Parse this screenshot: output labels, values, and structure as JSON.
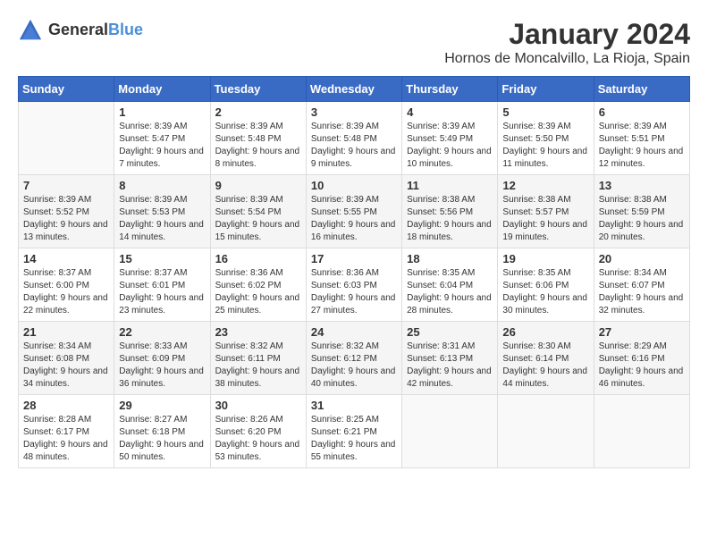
{
  "header": {
    "logo_general": "General",
    "logo_blue": "Blue",
    "month": "January 2024",
    "location": "Hornos de Moncalvillo, La Rioja, Spain"
  },
  "weekdays": [
    "Sunday",
    "Monday",
    "Tuesday",
    "Wednesday",
    "Thursday",
    "Friday",
    "Saturday"
  ],
  "weeks": [
    [
      {
        "day": "",
        "sunrise": "",
        "sunset": "",
        "daylight": ""
      },
      {
        "day": "1",
        "sunrise": "Sunrise: 8:39 AM",
        "sunset": "Sunset: 5:47 PM",
        "daylight": "Daylight: 9 hours and 7 minutes."
      },
      {
        "day": "2",
        "sunrise": "Sunrise: 8:39 AM",
        "sunset": "Sunset: 5:48 PM",
        "daylight": "Daylight: 9 hours and 8 minutes."
      },
      {
        "day": "3",
        "sunrise": "Sunrise: 8:39 AM",
        "sunset": "Sunset: 5:48 PM",
        "daylight": "Daylight: 9 hours and 9 minutes."
      },
      {
        "day": "4",
        "sunrise": "Sunrise: 8:39 AM",
        "sunset": "Sunset: 5:49 PM",
        "daylight": "Daylight: 9 hours and 10 minutes."
      },
      {
        "day": "5",
        "sunrise": "Sunrise: 8:39 AM",
        "sunset": "Sunset: 5:50 PM",
        "daylight": "Daylight: 9 hours and 11 minutes."
      },
      {
        "day": "6",
        "sunrise": "Sunrise: 8:39 AM",
        "sunset": "Sunset: 5:51 PM",
        "daylight": "Daylight: 9 hours and 12 minutes."
      }
    ],
    [
      {
        "day": "7",
        "sunrise": "Sunrise: 8:39 AM",
        "sunset": "Sunset: 5:52 PM",
        "daylight": "Daylight: 9 hours and 13 minutes."
      },
      {
        "day": "8",
        "sunrise": "Sunrise: 8:39 AM",
        "sunset": "Sunset: 5:53 PM",
        "daylight": "Daylight: 9 hours and 14 minutes."
      },
      {
        "day": "9",
        "sunrise": "Sunrise: 8:39 AM",
        "sunset": "Sunset: 5:54 PM",
        "daylight": "Daylight: 9 hours and 15 minutes."
      },
      {
        "day": "10",
        "sunrise": "Sunrise: 8:39 AM",
        "sunset": "Sunset: 5:55 PM",
        "daylight": "Daylight: 9 hours and 16 minutes."
      },
      {
        "day": "11",
        "sunrise": "Sunrise: 8:38 AM",
        "sunset": "Sunset: 5:56 PM",
        "daylight": "Daylight: 9 hours and 18 minutes."
      },
      {
        "day": "12",
        "sunrise": "Sunrise: 8:38 AM",
        "sunset": "Sunset: 5:57 PM",
        "daylight": "Daylight: 9 hours and 19 minutes."
      },
      {
        "day": "13",
        "sunrise": "Sunrise: 8:38 AM",
        "sunset": "Sunset: 5:59 PM",
        "daylight": "Daylight: 9 hours and 20 minutes."
      }
    ],
    [
      {
        "day": "14",
        "sunrise": "Sunrise: 8:37 AM",
        "sunset": "Sunset: 6:00 PM",
        "daylight": "Daylight: 9 hours and 22 minutes."
      },
      {
        "day": "15",
        "sunrise": "Sunrise: 8:37 AM",
        "sunset": "Sunset: 6:01 PM",
        "daylight": "Daylight: 9 hours and 23 minutes."
      },
      {
        "day": "16",
        "sunrise": "Sunrise: 8:36 AM",
        "sunset": "Sunset: 6:02 PM",
        "daylight": "Daylight: 9 hours and 25 minutes."
      },
      {
        "day": "17",
        "sunrise": "Sunrise: 8:36 AM",
        "sunset": "Sunset: 6:03 PM",
        "daylight": "Daylight: 9 hours and 27 minutes."
      },
      {
        "day": "18",
        "sunrise": "Sunrise: 8:35 AM",
        "sunset": "Sunset: 6:04 PM",
        "daylight": "Daylight: 9 hours and 28 minutes."
      },
      {
        "day": "19",
        "sunrise": "Sunrise: 8:35 AM",
        "sunset": "Sunset: 6:06 PM",
        "daylight": "Daylight: 9 hours and 30 minutes."
      },
      {
        "day": "20",
        "sunrise": "Sunrise: 8:34 AM",
        "sunset": "Sunset: 6:07 PM",
        "daylight": "Daylight: 9 hours and 32 minutes."
      }
    ],
    [
      {
        "day": "21",
        "sunrise": "Sunrise: 8:34 AM",
        "sunset": "Sunset: 6:08 PM",
        "daylight": "Daylight: 9 hours and 34 minutes."
      },
      {
        "day": "22",
        "sunrise": "Sunrise: 8:33 AM",
        "sunset": "Sunset: 6:09 PM",
        "daylight": "Daylight: 9 hours and 36 minutes."
      },
      {
        "day": "23",
        "sunrise": "Sunrise: 8:32 AM",
        "sunset": "Sunset: 6:11 PM",
        "daylight": "Daylight: 9 hours and 38 minutes."
      },
      {
        "day": "24",
        "sunrise": "Sunrise: 8:32 AM",
        "sunset": "Sunset: 6:12 PM",
        "daylight": "Daylight: 9 hours and 40 minutes."
      },
      {
        "day": "25",
        "sunrise": "Sunrise: 8:31 AM",
        "sunset": "Sunset: 6:13 PM",
        "daylight": "Daylight: 9 hours and 42 minutes."
      },
      {
        "day": "26",
        "sunrise": "Sunrise: 8:30 AM",
        "sunset": "Sunset: 6:14 PM",
        "daylight": "Daylight: 9 hours and 44 minutes."
      },
      {
        "day": "27",
        "sunrise": "Sunrise: 8:29 AM",
        "sunset": "Sunset: 6:16 PM",
        "daylight": "Daylight: 9 hours and 46 minutes."
      }
    ],
    [
      {
        "day": "28",
        "sunrise": "Sunrise: 8:28 AM",
        "sunset": "Sunset: 6:17 PM",
        "daylight": "Daylight: 9 hours and 48 minutes."
      },
      {
        "day": "29",
        "sunrise": "Sunrise: 8:27 AM",
        "sunset": "Sunset: 6:18 PM",
        "daylight": "Daylight: 9 hours and 50 minutes."
      },
      {
        "day": "30",
        "sunrise": "Sunrise: 8:26 AM",
        "sunset": "Sunset: 6:20 PM",
        "daylight": "Daylight: 9 hours and 53 minutes."
      },
      {
        "day": "31",
        "sunrise": "Sunrise: 8:25 AM",
        "sunset": "Sunset: 6:21 PM",
        "daylight": "Daylight: 9 hours and 55 minutes."
      },
      {
        "day": "",
        "sunrise": "",
        "sunset": "",
        "daylight": ""
      },
      {
        "day": "",
        "sunrise": "",
        "sunset": "",
        "daylight": ""
      },
      {
        "day": "",
        "sunrise": "",
        "sunset": "",
        "daylight": ""
      }
    ]
  ]
}
